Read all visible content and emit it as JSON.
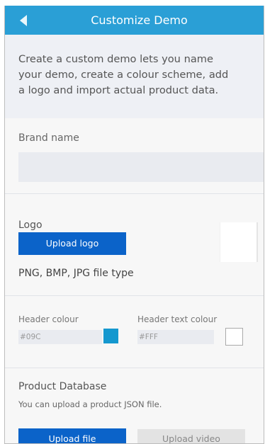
{
  "header": {
    "title": "Customize Demo",
    "back_icon": "back-arrow-icon",
    "background": "#2a9fd6"
  },
  "intro": {
    "line1": "Create a custom demo lets you name",
    "line2": "your demo, create a colour scheme, add",
    "line3": "a logo and import actual product data."
  },
  "brand": {
    "label": "Brand name",
    "value": "",
    "placeholder": ""
  },
  "logo": {
    "label": "Logo",
    "upload_button": "Upload logo",
    "file_types": "PNG, BMP, JPG file type"
  },
  "colours": {
    "header_colour_label": "Header colour",
    "header_colour_value": "#09C",
    "header_colour_swatch": "#1598cf",
    "header_text_colour_label": "Header text colour",
    "header_text_colour_value": "#FFF",
    "header_text_colour_swatch": "#ffffff"
  },
  "product": {
    "title": "Product Database",
    "subtitle": "You can upload a product JSON file.",
    "upload_file_button": "Upload file",
    "upload_video_button": "Upload video"
  },
  "colors": {
    "primary_button": "#0b63c9",
    "background": "#eef0f5"
  }
}
